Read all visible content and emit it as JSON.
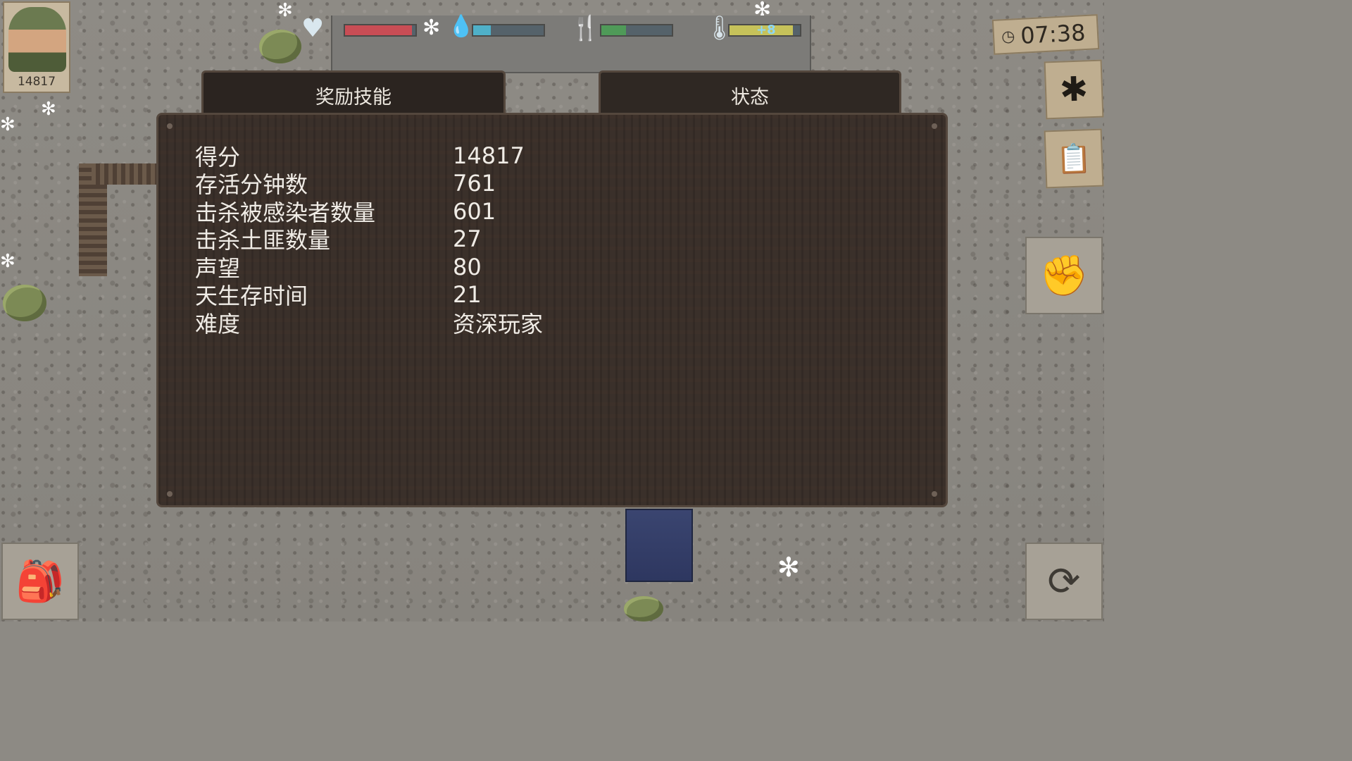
{
  "player": {
    "score_badge": "14817",
    "portrait_icon": "soldier-portrait-icon"
  },
  "status_bar": {
    "health": {
      "icon": "heart-icon",
      "level": 0.95,
      "color": "#c94d55"
    },
    "thirst": {
      "icon": "water-drop-icon",
      "level": 0.25,
      "color": "#4fb0c8"
    },
    "hunger": {
      "icon": "fork-knife-icon",
      "level": 0.35,
      "color": "#4f9a58"
    },
    "temperature": {
      "icon": "thermometer-icon",
      "level": 0.9,
      "color": "#c6c25a",
      "value": "+8"
    }
  },
  "clock": {
    "time": "07:38",
    "icon": "clock-icon"
  },
  "side_buttons": {
    "settings_icon": "gear-icon",
    "journal_icon": "notebook-question-icon",
    "hand_icon": "hand-grab-icon"
  },
  "tabs": [
    {
      "label": "奖励技能",
      "active": false
    },
    {
      "label": "状态",
      "active": true
    }
  ],
  "stats": [
    {
      "label": "得分",
      "value": "14817"
    },
    {
      "label": "存活分钟数",
      "value": "761"
    },
    {
      "label": "击杀被感染者数量",
      "value": "601"
    },
    {
      "label": "击杀土匪数量",
      "value": "27"
    },
    {
      "label": "声望",
      "value": "80"
    },
    {
      "label": "天生存时间",
      "value": "21"
    },
    {
      "label": "难度",
      "value": "资深玩家"
    }
  ],
  "inventory": {
    "backpack_icon": "backpack-icon",
    "action_icon": "swap-action-icon"
  },
  "colors": {
    "panel_bg": "#3a302a",
    "panel_border": "#54473d",
    "text": "#f0ece6"
  }
}
